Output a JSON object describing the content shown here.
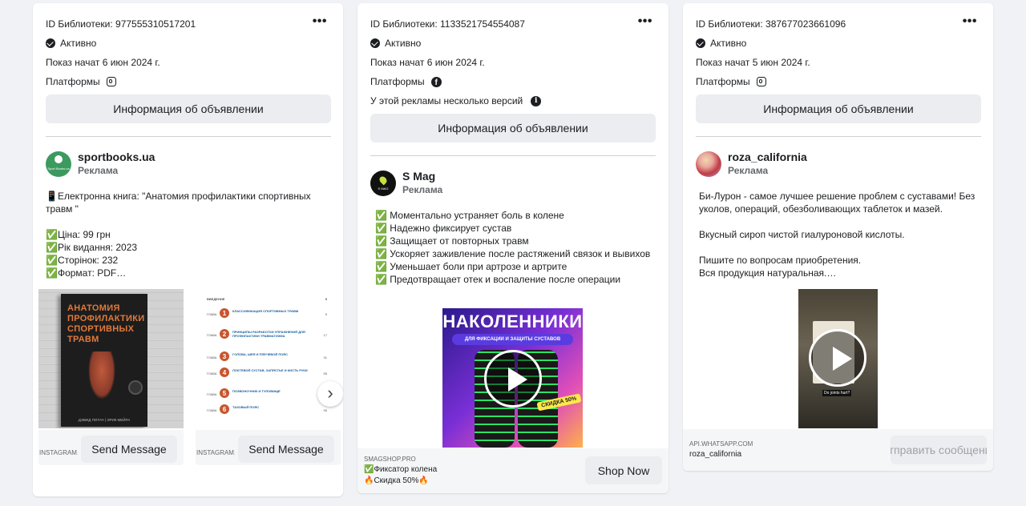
{
  "cards": [
    {
      "library_id": "ID Библиотеки: 977555310517201",
      "status": "Активно",
      "started": "Показ начат 6 июн 2024 г.",
      "platforms_label": "Платформы",
      "info_button": "Информация об объявлении",
      "advertiser": "sportbooks.ua",
      "sponsored": "Реклама",
      "avatar_text": "Sport Books.ua",
      "body": "📱Електронна книга: \"Анатомия профилактики спортивных травм \"\n\n✅Ціна: 99 грн\n✅Рік видання: 2023\n✅Сторінок: 232\n✅Формат: PDF…",
      "book": {
        "title": "АНАТОМИЯ ПРОФИЛАКТИКИ СПОРТИВНЫХ ТРАВМ",
        "authors": "ДЭВИД ПОТАЧ | ЭРИК МЕЙРА"
      },
      "toc": {
        "header": "ВВЕДЕНИЕ",
        "header_page": "5",
        "chapter_prefix": "ГЛАВА",
        "items": [
          {
            "num": "1",
            "title": "КЛАССИФИКАЦИЯ СПОРТИВНЫХ ТРАВМ",
            "page": "9"
          },
          {
            "num": "2",
            "title": "ПРИНЦИПЫ РАЗРАБОТКИ УПРАЖНЕНИЙ ДЛЯ ПРОФИЛАКТИКИ ТРАВМАТИЗМА",
            "page": "17"
          },
          {
            "num": "3",
            "title": "ГОЛОВА, ШЕЯ И ПЛЕЧЕВОЙ ПОЯС",
            "page": "31"
          },
          {
            "num": "4",
            "title": "ЛОКТЕВОЙ СУСТАВ, ЗАПЯСТЬЕ И КИСТЬ РУКИ",
            "page": "55"
          },
          {
            "num": "5",
            "title": "ПОЗВОНОЧНИК И ТУЛОВИЩЕ",
            "page": "77"
          },
          {
            "num": "6",
            "title": "ТАЗОВЫЙ ПОЯС",
            "page": "95"
          }
        ]
      },
      "carousel": [
        {
          "source": "INSTAGRAM.COM",
          "cta": "Send Message"
        },
        {
          "source": "INSTAGRAM.COM",
          "cta": "Send Message"
        }
      ],
      "next_arrow": "›"
    },
    {
      "library_id": "ID Библиотеки: 1133521754554087",
      "status": "Активно",
      "started": "Показ начат 6 июн 2024 г.",
      "platforms_label": "Платформы",
      "versions_note": "У этой рекламы несколько версий",
      "info_button": "Информация об объявлении",
      "advertiser": "S Mag",
      "sponsored": "Реклама",
      "avatar_text": "S MAG",
      "body": "✅ Моментально устраняет боль в колене\n✅ Надежно фиксирует сустав\n✅ Защищает от повторных травм\n✅ Ускоряет заживление после растяжений связок и вывихов\n✅ Уменьшает боли при артрозе и артрите\n✅ Предотвращает отек и воспаление после операции",
      "video": {
        "headline": "НАКОЛЕННИКИ",
        "subhead": "ДЛЯ ФИКСАЦИИ И ЗАЩИТЫ СУСТАВОВ",
        "badge": "СКИДКА 50%"
      },
      "footer": {
        "source": "SMAGSHOP.PRO",
        "line1": "✅Фиксатор колена",
        "line2": "🔥Скидка 50%🔥",
        "cta": "Shop Now"
      }
    },
    {
      "library_id": "ID Библиотеки: 387677023661096",
      "status": "Активно",
      "started": "Показ начат 5 июн 2024 г.",
      "platforms_label": "Платформы",
      "info_button": "Информация об объявлении",
      "advertiser": "roza_california",
      "sponsored": "Реклама",
      "body": "Би-Лурон - самое лучшее решение проблем с суставами! Без уколов, операций, обезболивающих таблеток и мазей.\n\nВкусный сироп чистой гиалуроновой кислоты.\n\nПишите по вопросам приобретения.\nВся продукция натуральная.…",
      "video": {
        "caption": "Do joints hurt?"
      },
      "footer": {
        "source": "API.WHATSAPP.COM",
        "line1": "roza_california",
        "cta": "Отправить сообщение"
      }
    }
  ],
  "colors": {
    "page_bg": "#f0f2f5",
    "card_bg": "#ffffff",
    "button_bg": "#ebedf0",
    "text": "#1c1e21",
    "muted": "#65676b"
  }
}
